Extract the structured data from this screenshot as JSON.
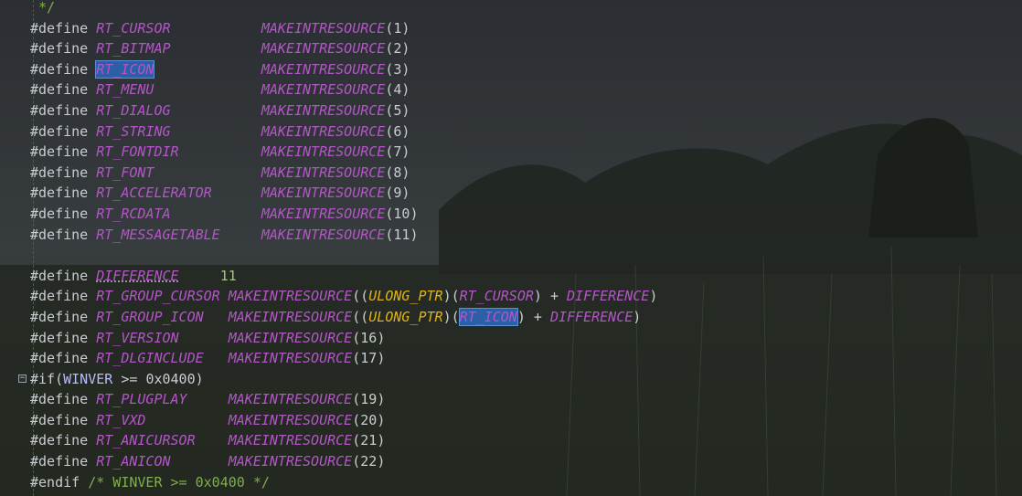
{
  "editor": {
    "lines": [
      {
        "type": "comment",
        "text": "*/"
      },
      {
        "type": "define",
        "name": "RT_CURSOR",
        "value_macro": "MAKEINTRESOURCE",
        "arg": "1",
        "pad": "           "
      },
      {
        "type": "define",
        "name": "RT_BITMAP",
        "value_macro": "MAKEINTRESOURCE",
        "arg": "2",
        "pad": "           "
      },
      {
        "type": "define",
        "name": "RT_ICON",
        "value_macro": "MAKEINTRESOURCE",
        "arg": "3",
        "pad": "             ",
        "selected": true
      },
      {
        "type": "define",
        "name": "RT_MENU",
        "value_macro": "MAKEINTRESOURCE",
        "arg": "4",
        "pad": "             "
      },
      {
        "type": "define",
        "name": "RT_DIALOG",
        "value_macro": "MAKEINTRESOURCE",
        "arg": "5",
        "pad": "           "
      },
      {
        "type": "define",
        "name": "RT_STRING",
        "value_macro": "MAKEINTRESOURCE",
        "arg": "6",
        "pad": "           "
      },
      {
        "type": "define",
        "name": "RT_FONTDIR",
        "value_macro": "MAKEINTRESOURCE",
        "arg": "7",
        "pad": "          "
      },
      {
        "type": "define",
        "name": "RT_FONT",
        "value_macro": "MAKEINTRESOURCE",
        "arg": "8",
        "pad": "             "
      },
      {
        "type": "define",
        "name": "RT_ACCELERATOR",
        "value_macro": "MAKEINTRESOURCE",
        "arg": "9",
        "pad": "      "
      },
      {
        "type": "define",
        "name": "RT_RCDATA",
        "value_macro": "MAKEINTRESOURCE",
        "arg": "10",
        "pad": "           "
      },
      {
        "type": "define",
        "name": "RT_MESSAGETABLE",
        "value_macro": "MAKEINTRESOURCE",
        "arg": "11",
        "pad": "     "
      },
      {
        "type": "blank"
      },
      {
        "type": "define_num",
        "name": "DIFFERENCE",
        "value": "11",
        "pad": "     "
      },
      {
        "type": "define_diff",
        "name": "RT_GROUP_CURSOR",
        "value_macro": "MAKEINTRESOURCE",
        "cast": "ULONG_PTR",
        "ref": "RT_CURSOR",
        "plus": "DIFFERENCE",
        "pad": " "
      },
      {
        "type": "define_diff",
        "name": "RT_GROUP_ICON",
        "value_macro": "MAKEINTRESOURCE",
        "cast": "ULONG_PTR",
        "ref": "RT_ICON",
        "plus": "DIFFERENCE",
        "pad": "   ",
        "ref_selected": true
      },
      {
        "type": "define",
        "name": "RT_VERSION",
        "value_macro": "MAKEINTRESOURCE",
        "arg": "16",
        "pad": "      "
      },
      {
        "type": "define",
        "name": "RT_DLGINCLUDE",
        "value_macro": "MAKEINTRESOURCE",
        "arg": "17",
        "pad": "   "
      },
      {
        "type": "if",
        "text_kw": "#if(",
        "var": "WINVER",
        "op": " >= ",
        "val": "0x0400",
        "close": ")"
      },
      {
        "type": "define",
        "name": "RT_PLUGPLAY",
        "value_macro": "MAKEINTRESOURCE",
        "arg": "19",
        "pad": "     "
      },
      {
        "type": "define",
        "name": "RT_VXD",
        "value_macro": "MAKEINTRESOURCE",
        "arg": "20",
        "pad": "          "
      },
      {
        "type": "define",
        "name": "RT_ANICURSOR",
        "value_macro": "MAKEINTRESOURCE",
        "arg": "21",
        "pad": "    "
      },
      {
        "type": "define",
        "name": "RT_ANICON",
        "value_macro": "MAKEINTRESOURCE",
        "arg": "22",
        "pad": "       "
      },
      {
        "type": "endif",
        "text_kw": "#endif",
        "comment": " /* WINVER >= 0x0400 */"
      }
    ],
    "define_kw": "#define "
  },
  "colors": {
    "macro": "#b455c8",
    "comment": "#7fae4f",
    "type": "#e0b219",
    "selection": "#2b5fa8",
    "text": "#c8ccd0"
  }
}
